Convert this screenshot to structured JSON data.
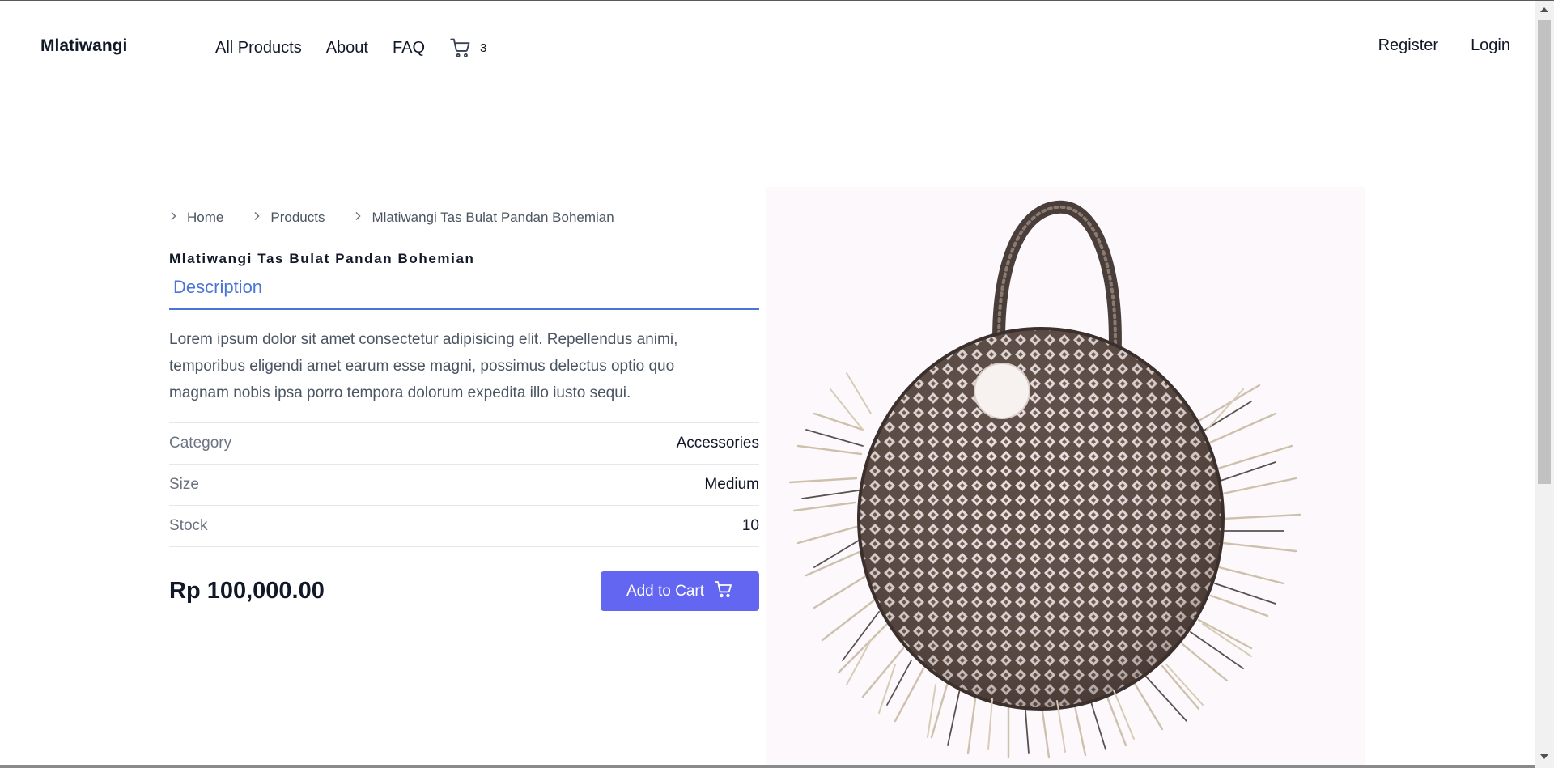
{
  "header": {
    "brand": "Mlatiwangi",
    "nav": {
      "all_products": "All Products",
      "about": "About",
      "faq": "FAQ",
      "cart_count": "3"
    },
    "auth": {
      "register": "Register",
      "login": "Login"
    }
  },
  "breadcrumb": {
    "home": "Home",
    "products": "Products",
    "current": "Mlatiwangi Tas Bulat Pandan Bohemian"
  },
  "product": {
    "title": "Mlatiwangi Tas Bulat Pandan Bohemian",
    "tab": "Description",
    "description": "Lorem ipsum dolor sit amet consectetur adipisicing elit. Repellendus animi, temporibus eligendi amet earum esse magni, possimus delectus optio quo magnam nobis ipsa porro tempora dolorum expedita illo iusto sequi.",
    "specs": [
      {
        "label": "Category",
        "value": "Accessories"
      },
      {
        "label": "Size",
        "value": "Medium"
      },
      {
        "label": "Stock",
        "value": "10"
      }
    ],
    "price": "Rp 100,000.00",
    "add_to_cart": "Add to Cart"
  },
  "colors": {
    "accent_tab": "#4a74d9",
    "button": "#6366f1"
  },
  "icons": {
    "cart": "cart-icon",
    "chevron": "chevron-right-icon",
    "product_image": "woven-round-bag-image"
  }
}
